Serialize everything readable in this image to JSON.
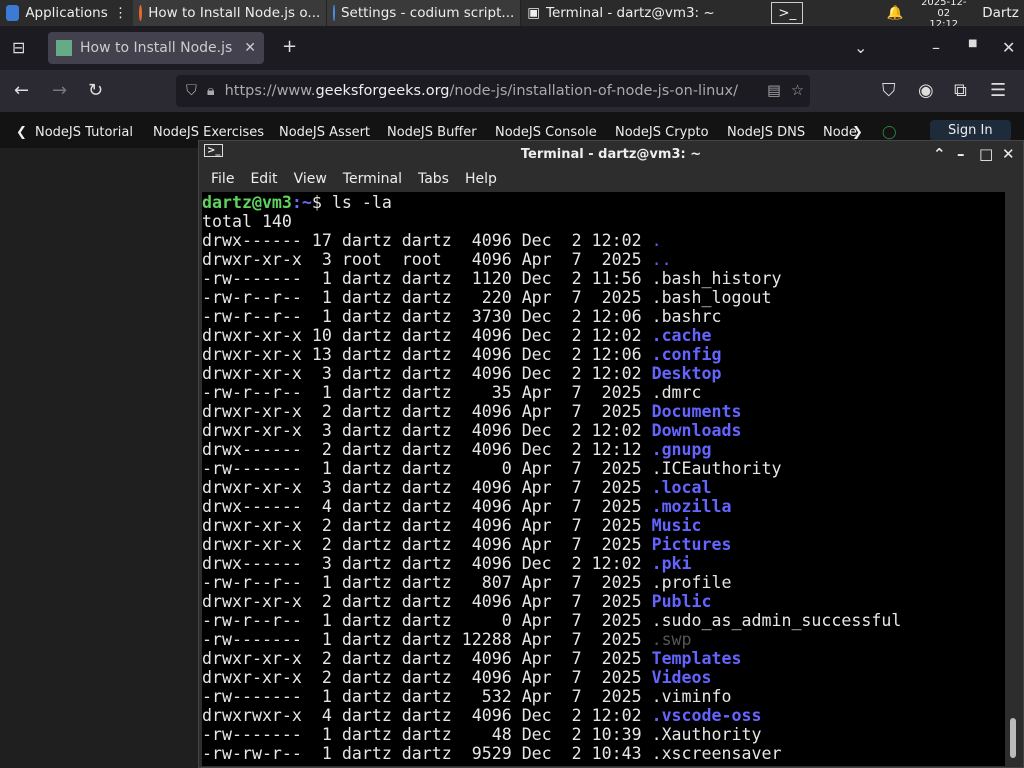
{
  "taskbar": {
    "applications": "Applications",
    "windows": [
      "How to Install Node.js o...",
      "Settings - codium script...",
      "Terminal - dartz@vm3: ~"
    ],
    "date": "2025-12-02",
    "time": "12:12",
    "user": "Dartz"
  },
  "browser": {
    "tab_title": "How to Install Node.js or",
    "url_prefix": "https://www.",
    "url_domain": "geeksforgeeks.org",
    "url_path": "/node-js/installation-of-node-js-on-linux/",
    "site_nav": [
      "NodeJS Tutorial",
      "NodeJS Exercises",
      "NodeJS Assert",
      "NodeJS Buffer",
      "NodeJS Console",
      "NodeJS Crypto",
      "NodeJS DNS",
      "Node"
    ],
    "sign_in": "Sign In"
  },
  "terminal": {
    "title": "Terminal - dartz@vm3: ~",
    "menu": [
      "File",
      "Edit",
      "View",
      "Terminal",
      "Tabs",
      "Help"
    ],
    "prompt_user": "dartz@vm3",
    "prompt_path": ":~",
    "prompt_sym": "$ ",
    "command": "ls -la",
    "total": "total 140",
    "rows": [
      {
        "p": "drwx------ 17 dartz dartz  4096 Dec  2 12:02 ",
        "n": ".",
        "k": "dir2"
      },
      {
        "p": "drwxr-xr-x  3 root  root   4096 Apr  7  2025 ",
        "n": "..",
        "k": "dir2"
      },
      {
        "p": "-rw-------  1 dartz dartz  1120 Dec  2 11:56 ",
        "n": ".bash_history",
        "k": "file"
      },
      {
        "p": "-rw-r--r--  1 dartz dartz   220 Apr  7  2025 ",
        "n": ".bash_logout",
        "k": "file"
      },
      {
        "p": "-rw-r--r--  1 dartz dartz  3730 Dec  2 12:06 ",
        "n": ".bashrc",
        "k": "file"
      },
      {
        "p": "drwxr-xr-x 10 dartz dartz  4096 Dec  2 12:02 ",
        "n": ".cache",
        "k": "dir"
      },
      {
        "p": "drwxr-xr-x 13 dartz dartz  4096 Dec  2 12:06 ",
        "n": ".config",
        "k": "dir"
      },
      {
        "p": "drwxr-xr-x  3 dartz dartz  4096 Dec  2 12:02 ",
        "n": "Desktop",
        "k": "dir"
      },
      {
        "p": "-rw-r--r--  1 dartz dartz    35 Apr  7  2025 ",
        "n": ".dmrc",
        "k": "file"
      },
      {
        "p": "drwxr-xr-x  2 dartz dartz  4096 Apr  7  2025 ",
        "n": "Documents",
        "k": "dir"
      },
      {
        "p": "drwxr-xr-x  3 dartz dartz  4096 Dec  2 12:02 ",
        "n": "Downloads",
        "k": "dir"
      },
      {
        "p": "drwx------  2 dartz dartz  4096 Dec  2 12:12 ",
        "n": ".gnupg",
        "k": "dir"
      },
      {
        "p": "-rw-------  1 dartz dartz     0 Apr  7  2025 ",
        "n": ".ICEauthority",
        "k": "file"
      },
      {
        "p": "drwxr-xr-x  3 dartz dartz  4096 Apr  7  2025 ",
        "n": ".local",
        "k": "dir"
      },
      {
        "p": "drwx------  4 dartz dartz  4096 Apr  7  2025 ",
        "n": ".mozilla",
        "k": "dir"
      },
      {
        "p": "drwxr-xr-x  2 dartz dartz  4096 Apr  7  2025 ",
        "n": "Music",
        "k": "dir"
      },
      {
        "p": "drwxr-xr-x  2 dartz dartz  4096 Apr  7  2025 ",
        "n": "Pictures",
        "k": "dir"
      },
      {
        "p": "drwx------  3 dartz dartz  4096 Dec  2 12:02 ",
        "n": ".pki",
        "k": "dir"
      },
      {
        "p": "-rw-r--r--  1 dartz dartz   807 Apr  7  2025 ",
        "n": ".profile",
        "k": "file"
      },
      {
        "p": "drwxr-xr-x  2 dartz dartz  4096 Apr  7  2025 ",
        "n": "Public",
        "k": "dir"
      },
      {
        "p": "-rw-r--r--  1 dartz dartz     0 Apr  7  2025 ",
        "n": ".sudo_as_admin_successful",
        "k": "file"
      },
      {
        "p": "-rw-------  1 dartz dartz 12288 Apr  7  2025 ",
        "n": ".swp",
        "k": "dim"
      },
      {
        "p": "drwxr-xr-x  2 dartz dartz  4096 Apr  7  2025 ",
        "n": "Templates",
        "k": "dir"
      },
      {
        "p": "drwxr-xr-x  2 dartz dartz  4096 Apr  7  2025 ",
        "n": "Videos",
        "k": "dir"
      },
      {
        "p": "-rw-------  1 dartz dartz   532 Apr  7  2025 ",
        "n": ".viminfo",
        "k": "file"
      },
      {
        "p": "drwxrwxr-x  4 dartz dartz  4096 Dec  2 12:02 ",
        "n": ".vscode-oss",
        "k": "dir"
      },
      {
        "p": "-rw-------  1 dartz dartz    48 Dec  2 10:39 ",
        "n": ".Xauthority",
        "k": "file"
      },
      {
        "p": "-rw-rw-r--  1 dartz dartz  9529 Dec  2 10:43 ",
        "n": ".xscreensaver",
        "k": "file"
      }
    ]
  }
}
